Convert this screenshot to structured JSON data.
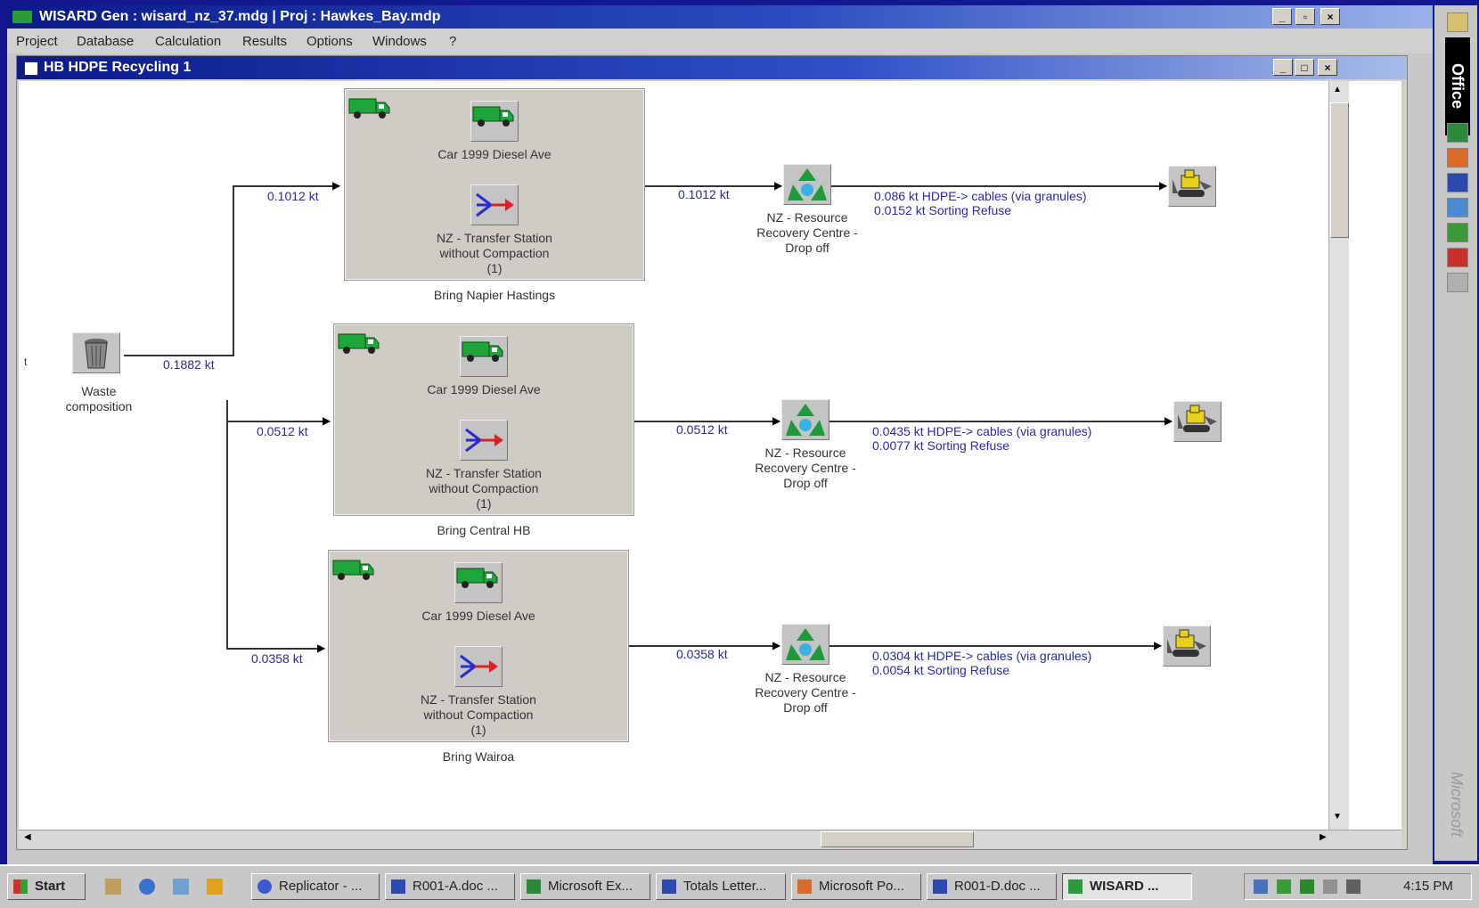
{
  "app": {
    "title": "WISARD   Gen : wisard_nz_37.mdg  |  Proj : Hawkes_Bay.mdp",
    "window_buttons": [
      "_",
      "▫",
      "×"
    ]
  },
  "menu": [
    "Project",
    "Database",
    "Calculation",
    "Results",
    "Options",
    "Windows",
    "?"
  ],
  "child_window": {
    "title": "HB HDPE Recycling 1",
    "buttons": [
      "_",
      "□",
      "×"
    ]
  },
  "diagram": {
    "source": {
      "label": "Waste composition",
      "flow": "0.1882 kt"
    },
    "rows": [
      {
        "in_flow": "0.1012 kt",
        "transport": "Car 1999 Diesel Ave",
        "transfer": "NZ - Transfer Station without Compaction (1)",
        "group_label": "Bring Napier Hastings",
        "out_flow": "0.1012 kt",
        "facility": "NZ - Resource Recovery Centre - Drop off",
        "outputs": [
          "0.086 kt  HDPE-> cables (via granules)",
          "0.0152 kt Sorting Refuse"
        ]
      },
      {
        "in_flow": "0.0512 kt",
        "transport": "Car 1999 Diesel Ave",
        "transfer": "NZ - Transfer Station without Compaction (1)",
        "group_label": "Bring Central HB",
        "out_flow": "0.0512 kt",
        "facility": "NZ - Resource Recovery Centre - Drop off",
        "outputs": [
          "0.0435 kt HDPE-> cables (via granules)",
          "0.0077 kt Sorting Refuse"
        ]
      },
      {
        "in_flow": "0.0358 kt",
        "transport": "Car 1999 Diesel Ave",
        "transfer": "NZ - Transfer Station without Compaction (1)",
        "group_label": "Bring Wairoa",
        "out_flow": "0.0358 kt",
        "facility": "NZ - Resource Recovery Centre - Drop off",
        "outputs": [
          "0.0304 kt HDPE-> cables (via granules)",
          "0.0054 kt Sorting Refuse"
        ]
      }
    ]
  },
  "office_bar": {
    "title": "Office",
    "vendor": "Microsoft"
  },
  "taskbar": {
    "start": "Start",
    "tasks": [
      "Replicator - ...",
      "R001-A.doc ...",
      "Microsoft Ex...",
      "Totals Letter...",
      "Microsoft Po...",
      "R001-D.doc ...",
      "WISARD ..."
    ],
    "clock": "4:15 PM"
  },
  "colors": {
    "titlebar": "#0a1a8a",
    "desktop": "#13188f",
    "flow_text": "#2a2aa8",
    "truck_green": "#1fa63a"
  }
}
